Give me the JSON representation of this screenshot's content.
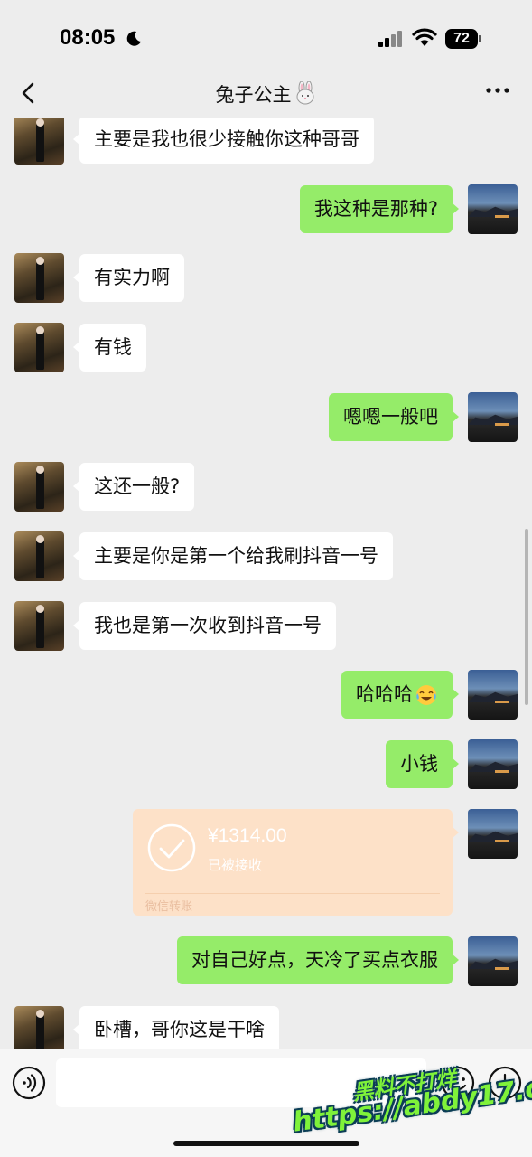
{
  "status_bar": {
    "time": "08:05",
    "battery": "72",
    "icons": [
      "moon-icon",
      "signal-icon",
      "wifi-icon",
      "battery-icon"
    ]
  },
  "nav": {
    "title": "兔子公主",
    "title_emoji": "rabbit-face-icon",
    "back_icon": "chevron-left-icon",
    "more_icon": "more-dots-icon"
  },
  "colors": {
    "background": "#ededed",
    "sent_bubble": "#95ec69",
    "received_bubble": "#ffffff",
    "transfer_card": "#fde1c8"
  },
  "messages": [
    {
      "side": "left",
      "text": "主要是我也很少接触你这种哥哥"
    },
    {
      "side": "right",
      "text": "我这种是那种?"
    },
    {
      "side": "left",
      "text": "有实力啊"
    },
    {
      "side": "left",
      "text": "有钱"
    },
    {
      "side": "right",
      "text": "嗯嗯一般吧"
    },
    {
      "side": "left",
      "text": "这还一般?"
    },
    {
      "side": "left",
      "text": "主要是你是第一个给我刷抖音一号"
    },
    {
      "side": "left",
      "text": "我也是第一次收到抖音一号"
    },
    {
      "side": "right",
      "text": "哈哈哈",
      "emoji": "tears-of-joy-icon"
    },
    {
      "side": "right",
      "text": "小钱"
    },
    {
      "side": "right",
      "type": "transfer",
      "amount": "¥1314.00",
      "status": "已被接收",
      "label": "微信转账"
    },
    {
      "side": "right",
      "text": "对自己好点，天冷了买点衣服"
    },
    {
      "side": "left",
      "text": "卧槽，哥你这是干啥"
    }
  ],
  "input_bar": {
    "voice_icon": "voice-icon",
    "emoji_icon": "smiley-icon",
    "add_icon": "plus-circle-icon",
    "input_value": ""
  },
  "watermark": {
    "line1": "黑料不打烊",
    "line2": "https://abdy17.com"
  }
}
